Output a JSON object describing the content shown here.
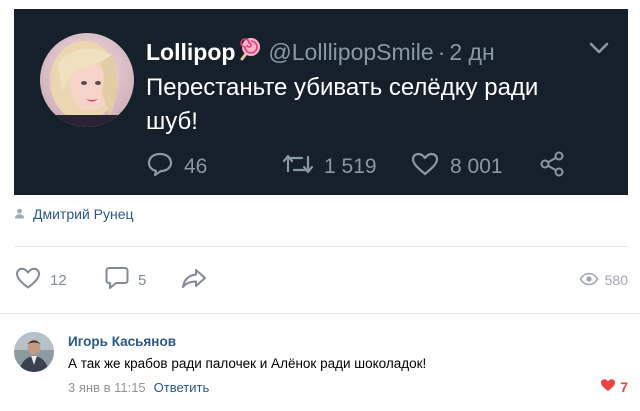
{
  "tweet": {
    "name": "Lollipop",
    "handle": "@LolllipopSmile",
    "separator": "·",
    "time": "2 дн",
    "text": "Перестаньте убивать селёдку ради шуб!",
    "replies": "46",
    "retweets": "1 519",
    "likes": "8 001"
  },
  "post": {
    "author": "Дмитрий Рунец",
    "likes": "12",
    "comments": "5",
    "views": "580"
  },
  "comment": {
    "author": "Игорь Касьянов",
    "text": "А так же крабов ради палочек и Алёнок ради шоколадок!",
    "date": "3 янв в 11:15",
    "reply_label": "Ответить",
    "likes": "7"
  },
  "colors": {
    "tweet_bg": "#15202b",
    "vk_link": "#2a5885",
    "like_red": "#e64646"
  }
}
